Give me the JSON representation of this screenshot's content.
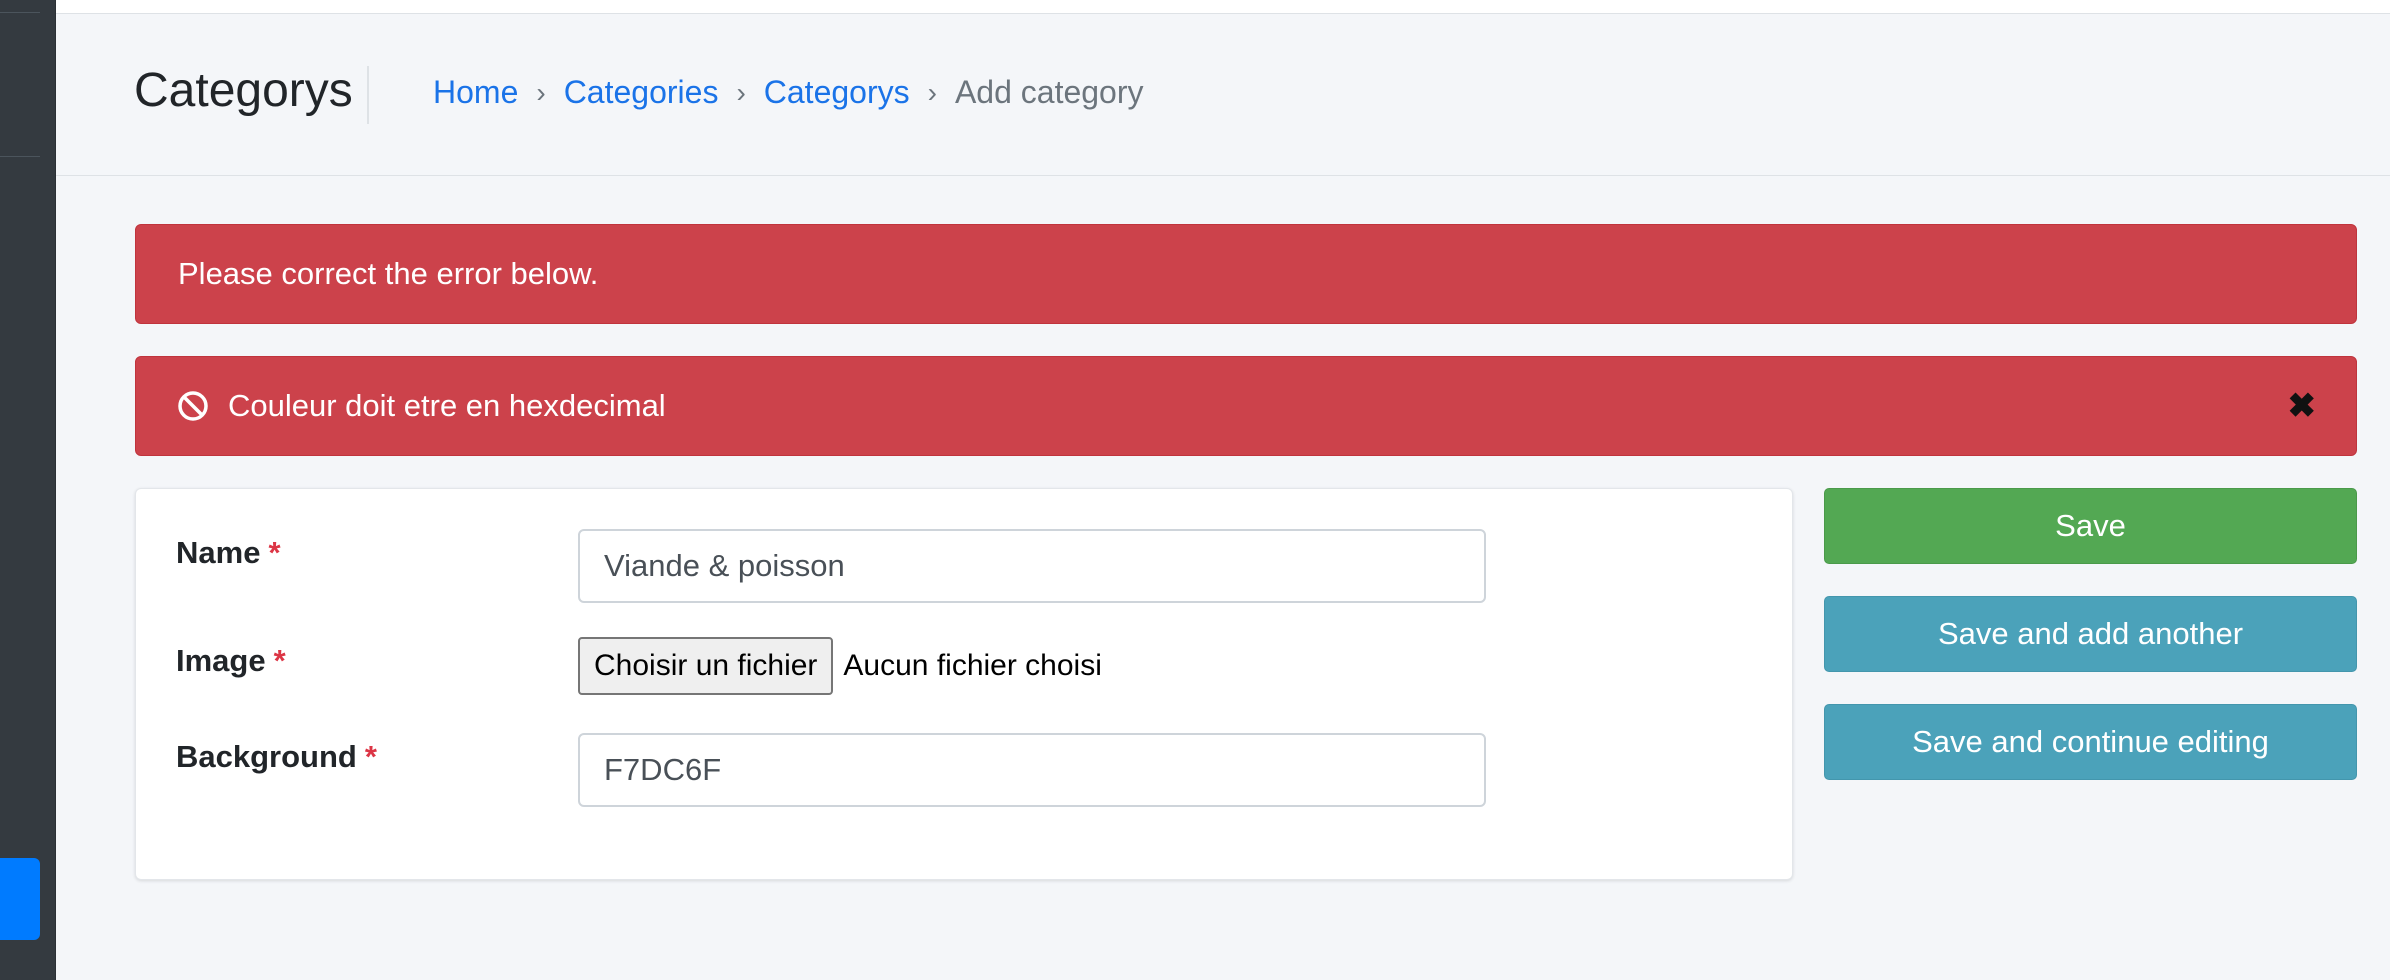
{
  "header": {
    "title": "Categorys",
    "breadcrumb": [
      {
        "label": "Home"
      },
      {
        "label": "Categories"
      },
      {
        "label": "Categorys"
      }
    ],
    "breadcrumb_separator": "›",
    "breadcrumb_current": "Add category"
  },
  "alerts": {
    "main_message": "Please correct the error below.",
    "error_message": "Couleur doit etre en hexdecimal",
    "error_icon": "ban-icon",
    "close_label": "✖"
  },
  "form": {
    "name_label": "Name",
    "name_value": "Viande & poisson",
    "image_label": "Image",
    "file_button_label": "Choisir un fichier",
    "file_status": "Aucun fichier choisi",
    "background_label": "Background",
    "background_value": "F7DC6F",
    "required_marker": "*"
  },
  "actions": {
    "save_label": "Save",
    "save_add_label": "Save and add another",
    "save_continue_label": "Save and continue editing"
  },
  "colors": {
    "danger": "#cc424b",
    "success": "#53a853",
    "info": "#4ba2ba",
    "link": "#1a73e8",
    "sidebar": "#343a40",
    "sidebar_active": "#007bff"
  }
}
